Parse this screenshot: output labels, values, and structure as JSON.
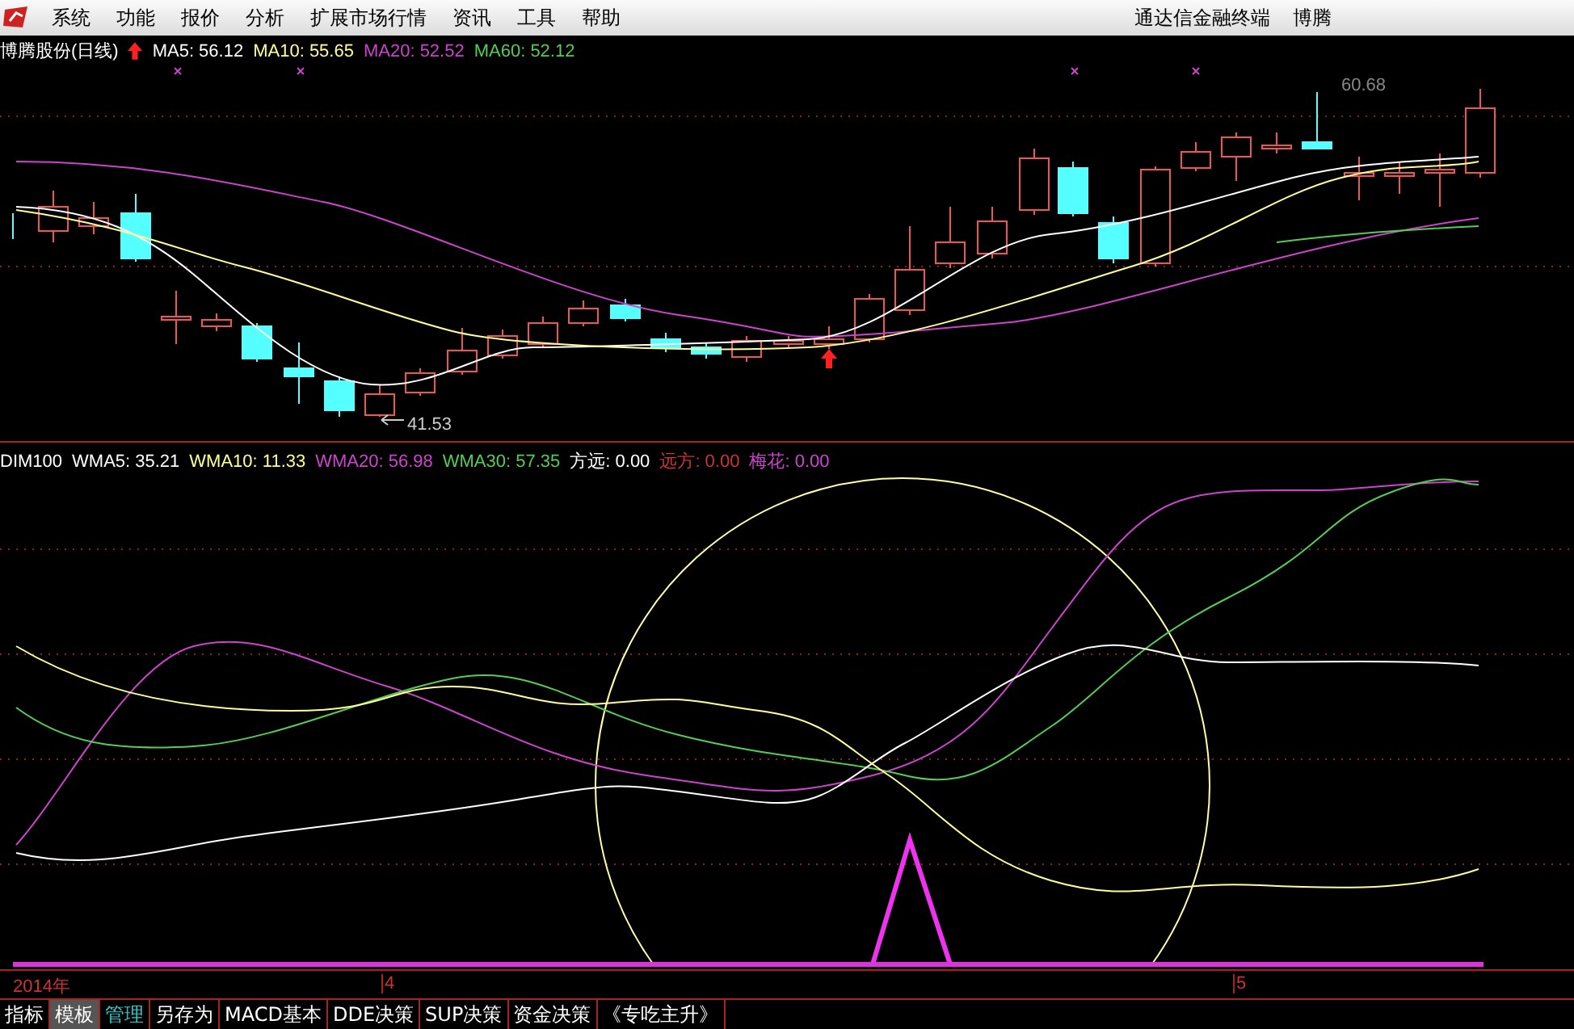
{
  "menu": {
    "items": [
      "系统",
      "功能",
      "报价",
      "分析",
      "扩展市场行情",
      "资讯",
      "工具",
      "帮助"
    ],
    "right_texts": [
      "通达信金融终端",
      "博腾"
    ]
  },
  "price_panel": {
    "title": "博腾股份(日线)",
    "indicators": [
      {
        "label": "MA5: 56.12",
        "color": "#ffffff"
      },
      {
        "label": "MA10: 55.65",
        "color": "#ffff99"
      },
      {
        "label": "MA20: 52.52",
        "color": "#cc44cc"
      },
      {
        "label": "MA60: 52.12",
        "color": "#55cc55"
      }
    ],
    "low_label": "41.53",
    "high_label": "60.68"
  },
  "indicator_panel": {
    "name": "DIM100",
    "indicators": [
      {
        "label": "WMA5: 35.21",
        "color": "#ffffff"
      },
      {
        "label": "WMA10: 11.33",
        "color": "#ffff99"
      },
      {
        "label": "WMA20: 56.98",
        "color": "#cc44cc"
      },
      {
        "label": "WMA30: 57.35",
        "color": "#55cc55"
      },
      {
        "label": "方远: 0.00",
        "color": "#ffffff"
      },
      {
        "label": "远方: 0.00",
        "color": "#cc3333"
      },
      {
        "label": "梅花: 0.00",
        "color": "#cc44cc"
      }
    ]
  },
  "x_axis": {
    "labels": [
      "2014年",
      "4",
      "5"
    ]
  },
  "bottom_tabs": [
    {
      "label": "指标",
      "selected": false,
      "kind": "normal"
    },
    {
      "label": "模板",
      "selected": true,
      "kind": "normal"
    },
    {
      "label": "管理",
      "selected": false,
      "kind": "highlight"
    },
    {
      "label": "另存为",
      "selected": false,
      "kind": "normal"
    },
    {
      "label": "MACD基本",
      "selected": false,
      "kind": "normal"
    },
    {
      "label": "DDE决策",
      "selected": false,
      "kind": "normal"
    },
    {
      "label": "SUP决策",
      "selected": false,
      "kind": "normal"
    },
    {
      "label": "资金决策",
      "selected": false,
      "kind": "normal"
    },
    {
      "label": "《专吃主升》",
      "selected": false,
      "kind": "normal"
    }
  ]
}
